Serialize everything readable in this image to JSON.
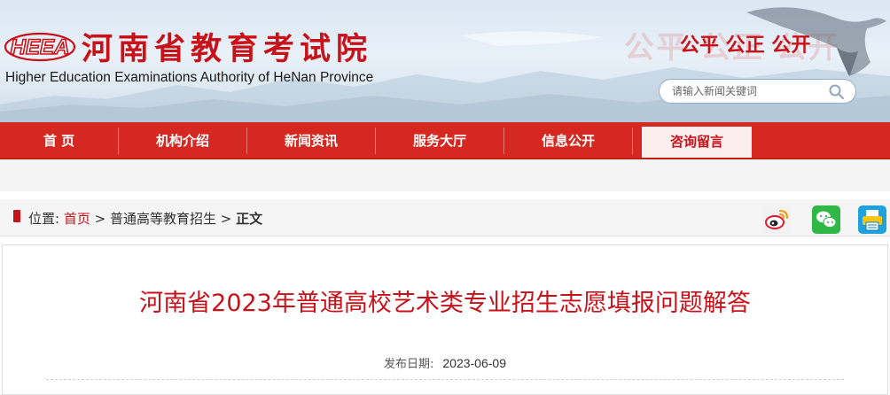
{
  "header": {
    "logo_text": "HEEA",
    "title_cn": "河南省教育考试院",
    "title_en": "Higher Education Examinations Authority of HeNan Province",
    "motto": "公平 公正 公开",
    "search_placeholder": "请输入新闻关键词"
  },
  "nav": {
    "items": [
      {
        "label": "首 页"
      },
      {
        "label": "机构介绍"
      },
      {
        "label": "新闻资讯"
      },
      {
        "label": "服务大厅"
      },
      {
        "label": "信息公开"
      },
      {
        "label": "咨询留言"
      }
    ],
    "active_index": 5
  },
  "breadcrumb": {
    "prefix": "位置:",
    "home": "首页",
    "separator": ">",
    "section": "普通高等教育招生",
    "current": "正文"
  },
  "share": {
    "icons": [
      "weibo-icon",
      "wechat-icon",
      "print-icon"
    ]
  },
  "article": {
    "title": "河南省2023年普通高校艺术类专业招生志愿填报问题解答",
    "date_label": "发布日期:",
    "date": "2023-06-09"
  },
  "colors": {
    "brand_red": "#c8121a",
    "nav_red": "#d42821",
    "nav_active_bg": "#fbeeee"
  }
}
